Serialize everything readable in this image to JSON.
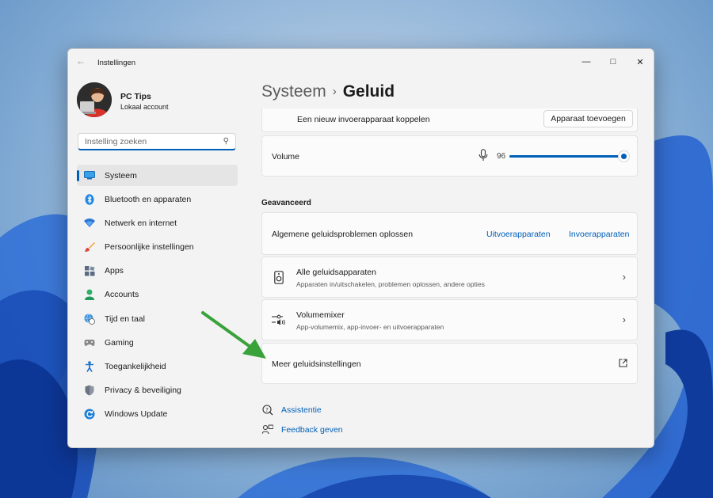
{
  "window": {
    "title": "Instellingen"
  },
  "profile": {
    "name": "PC Tips",
    "account": "Lokaal account"
  },
  "search": {
    "placeholder": "Instelling zoeken"
  },
  "sidebar": {
    "items": [
      {
        "label": "Systeem",
        "icon": "monitor-icon",
        "active": true
      },
      {
        "label": "Bluetooth en apparaten",
        "icon": "bluetooth-icon"
      },
      {
        "label": "Netwerk en internet",
        "icon": "wifi-icon"
      },
      {
        "label": "Persoonlijke instellingen",
        "icon": "brush-icon"
      },
      {
        "label": "Apps",
        "icon": "apps-icon"
      },
      {
        "label": "Accounts",
        "icon": "person-icon"
      },
      {
        "label": "Tijd en taal",
        "icon": "globe-clock-icon"
      },
      {
        "label": "Gaming",
        "icon": "gamepad-icon"
      },
      {
        "label": "Toegankelijkheid",
        "icon": "accessibility-icon"
      },
      {
        "label": "Privacy & beveiliging",
        "icon": "shield-icon"
      },
      {
        "label": "Windows Update",
        "icon": "update-icon"
      }
    ]
  },
  "breadcrumb": {
    "parent": "Systeem",
    "separator": "›",
    "current": "Geluid"
  },
  "input_device": {
    "label": "Een nieuw invoerapparaat koppelen",
    "button": "Apparaat toevoegen"
  },
  "volume": {
    "label": "Volume",
    "value": "96",
    "level": 0.96
  },
  "advanced": {
    "heading": "Geavanceerd",
    "troubleshoot": {
      "label": "Algemene geluidsproblemen oplossen",
      "link_output": "Uitvoerapparaten",
      "link_input": "Invoerapparaten"
    },
    "all_devices": {
      "title": "Alle geluidsapparaten",
      "subtitle": "Apparaten in/uitschakelen, problemen oplossen, andere opties"
    },
    "mixer": {
      "title": "Volumemixer",
      "subtitle": "App-volumemix, app-invoer- en uitvoerapparaten"
    },
    "more": {
      "label": "Meer geluidsinstellingen"
    }
  },
  "footer": {
    "help": "Assistentie",
    "feedback": "Feedback geven"
  },
  "colors": {
    "accent": "#005fb8",
    "annotation_arrow": "#3aa23a"
  }
}
